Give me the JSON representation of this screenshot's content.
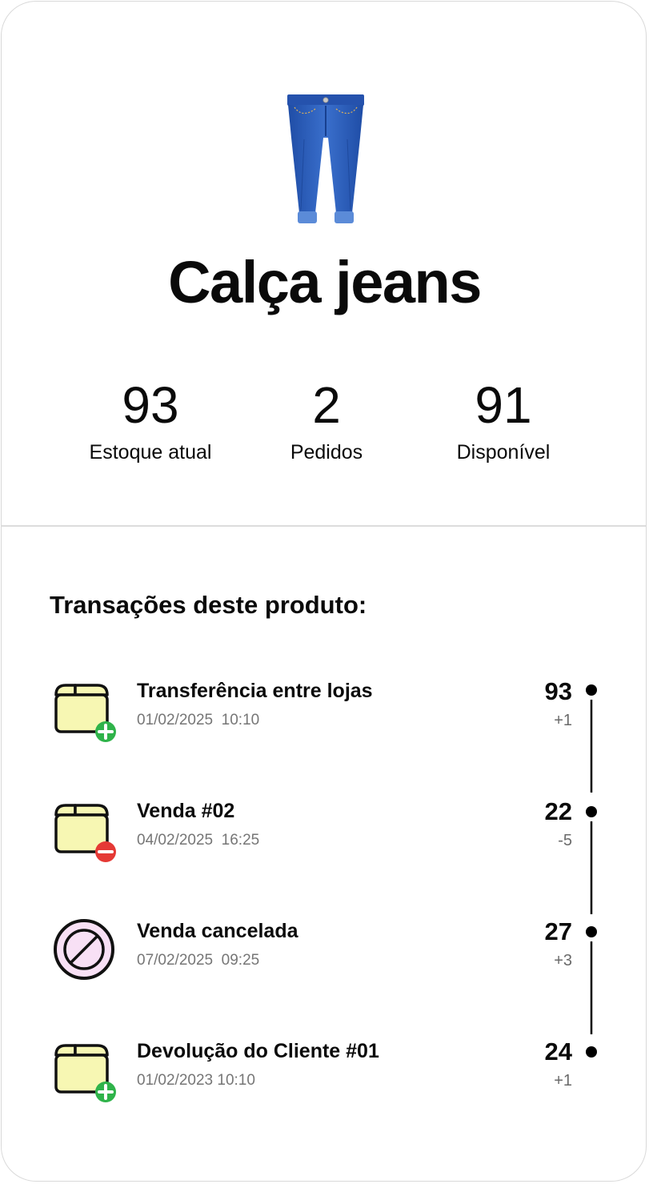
{
  "product": {
    "name": "Calça jeans",
    "image_icon": "jeans-image"
  },
  "stats": [
    {
      "value": "93",
      "label": "Estoque atual"
    },
    {
      "value": "2",
      "label": "Pedidos"
    },
    {
      "value": "91",
      "label": "Disponível"
    }
  ],
  "transactions_title": "Transações deste produto:",
  "transactions": [
    {
      "title": "Transferência entre lojas",
      "datetime": "01/02/2025  10:10",
      "balance": "93",
      "delta": "+1",
      "icon": "box-add-icon"
    },
    {
      "title": "Venda #02",
      "datetime": "04/02/2025  16:25",
      "balance": "22",
      "delta": "-5",
      "icon": "box-remove-icon"
    },
    {
      "title": "Venda cancelada",
      "datetime": "07/02/2025  09:25",
      "balance": "27",
      "delta": "+3",
      "icon": "cancel-icon"
    },
    {
      "title": "Devolução do Cliente #01",
      "datetime": "01/02/2023 10:10",
      "balance": "24",
      "delta": "+1",
      "icon": "box-add-icon"
    }
  ],
  "colors": {
    "box_fill": "#f7f7b3",
    "add_badge": "#2fb34a",
    "remove_badge": "#e53935",
    "cancel_fill": "#f8e0f5",
    "jeans_blue": "#2f5fb8"
  }
}
